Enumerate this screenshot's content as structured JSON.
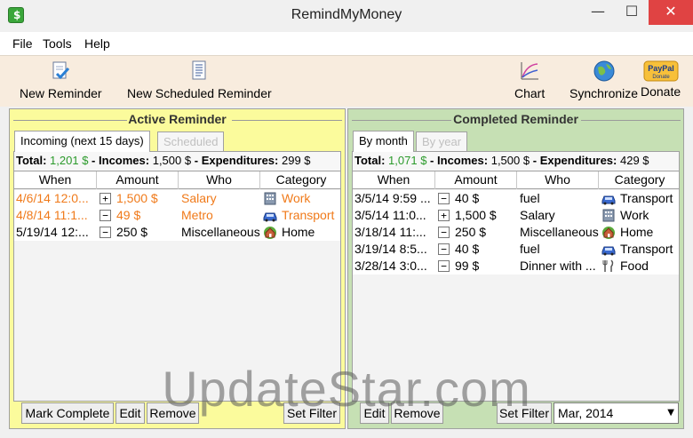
{
  "window": {
    "title": "RemindMyMoney",
    "minimize": "—",
    "maximize": "☐",
    "close": "✕"
  },
  "menu": [
    "File",
    "Tools",
    "Help"
  ],
  "toolbar": {
    "new_reminder": "New Reminder",
    "new_scheduled": "New Scheduled Reminder",
    "chart": "Chart",
    "synchronize": "Synchronize",
    "donate": "Donate",
    "paypal_text": "PayPal",
    "paypal_sub": "Donate"
  },
  "colors": {
    "active_panel": "#fbfb9c",
    "completed_panel": "#c6e0b4",
    "income_green": "#2b9a2b",
    "overdue_orange": "#f07a1a",
    "close_red": "#e04343"
  },
  "active": {
    "title": "Active Reminder",
    "tabs": [
      "Incoming (next 15 days)",
      "Scheduled"
    ],
    "summary": {
      "total_label": "Total:",
      "total": "1,201 $",
      "sep": "-",
      "incomes_label": "Incomes:",
      "incomes": "1,500 $",
      "expenditures_label": "Expenditures:",
      "expenditures": "299 $"
    },
    "columns": [
      "When",
      "Amount",
      "Who",
      "Category"
    ],
    "rows": [
      {
        "when": "4/6/14 12:0...",
        "sign": "+",
        "amount": "1,500 $",
        "who": "Salary",
        "category": "Work",
        "icon": "building-icon",
        "overdue": true
      },
      {
        "when": "4/8/14 11:1...",
        "sign": "−",
        "amount": "49 $",
        "who": "Metro",
        "category": "Transport",
        "icon": "car-icon",
        "overdue": true
      },
      {
        "when": "5/19/14 12:...",
        "sign": "−",
        "amount": "250 $",
        "who": "Miscellaneous",
        "category": "Home",
        "icon": "house-icon",
        "overdue": false
      }
    ],
    "buttons": {
      "mark_complete": "Mark Complete",
      "edit": "Edit",
      "remove": "Remove",
      "set_filter": "Set Filter"
    }
  },
  "completed": {
    "title": "Completed Reminder",
    "tabs": [
      "By month",
      "By year"
    ],
    "summary": {
      "total_label": "Total:",
      "total": "1,071 $",
      "sep": "-",
      "incomes_label": "Incomes:",
      "incomes": "1,500 $",
      "expenditures_label": "Expenditures:",
      "expenditures": "429 $"
    },
    "columns": [
      "When",
      "Amount",
      "Who",
      "Category"
    ],
    "rows": [
      {
        "when": "3/5/14 9:59 ...",
        "sign": "−",
        "amount": "40 $",
        "who": "fuel",
        "category": "Transport",
        "icon": "car-icon"
      },
      {
        "when": "3/5/14 11:0...",
        "sign": "+",
        "amount": "1,500 $",
        "who": "Salary",
        "category": "Work",
        "icon": "building-icon"
      },
      {
        "when": "3/18/14 11:...",
        "sign": "−",
        "amount": "250 $",
        "who": "Miscellaneous",
        "category": "Home",
        "icon": "house-icon"
      },
      {
        "when": "3/19/14 8:5...",
        "sign": "−",
        "amount": "40 $",
        "who": "fuel",
        "category": "Transport",
        "icon": "car-icon"
      },
      {
        "when": "3/28/14 3:0...",
        "sign": "−",
        "amount": "99 $",
        "who": "Dinner with ...",
        "category": "Food",
        "icon": "fork-knife-icon"
      }
    ],
    "buttons": {
      "edit": "Edit",
      "remove": "Remove",
      "set_filter": "Set Filter"
    },
    "month_select": "Mar, 2014"
  },
  "watermark": "UpdateStar.com"
}
